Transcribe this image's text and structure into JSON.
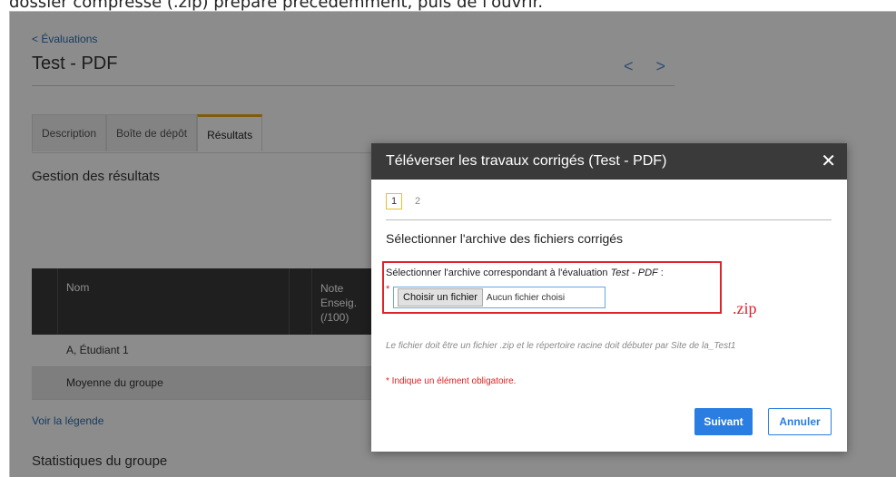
{
  "top_caption": "dossier compressé (.zip) préparé précédemment, puis de l'ouvrir.",
  "background": {
    "back_link": "< Évaluations",
    "page_title": "Test - PDF",
    "nav_arrows": "< >",
    "tabs": [
      {
        "label": "Description"
      },
      {
        "label": "Boîte de dépôt"
      },
      {
        "label": "Résultats",
        "active": true
      }
    ],
    "section_title": "Gestion des résultats",
    "table": {
      "headers": [
        "Nom",
        "Note\nEnseig.\n(/100)"
      ],
      "rows": [
        {
          "name": "A, Étudiant 1"
        },
        {
          "name": "Moyenne du groupe"
        }
      ]
    },
    "legend_link": "Voir la légende",
    "stats_title": "Statistiques du groupe"
  },
  "dialog": {
    "title": "Téléverser les travaux corrigés (Test - PDF)",
    "close_icon": "close-icon",
    "steps": [
      "1",
      "2"
    ],
    "current_step": 1,
    "subtitle": "Sélectionner l'archive des fichiers corrigés",
    "field_label_prefix": "Sélectionner l'archive correspondant à l'évaluation ",
    "field_label_eval": "Test - PDF",
    "field_label_suffix": " :",
    "required_marker": "*",
    "choose_button": "Choisir un fichier",
    "no_file": "Aucun fichier choisi",
    "annotation": ".zip",
    "hint": "Le fichier doit être un fichier .zip et le répertoire racine doit débuter par Site de la_Test1",
    "required_note": "* Indique un élément obligatoire.",
    "next_button": "Suivant",
    "cancel_button": "Annuler"
  },
  "colors": {
    "accent": "#2a7de1",
    "highlight": "#e0222a",
    "tab_active": "#e6a817",
    "header_dark": "#3a3a3a"
  }
}
